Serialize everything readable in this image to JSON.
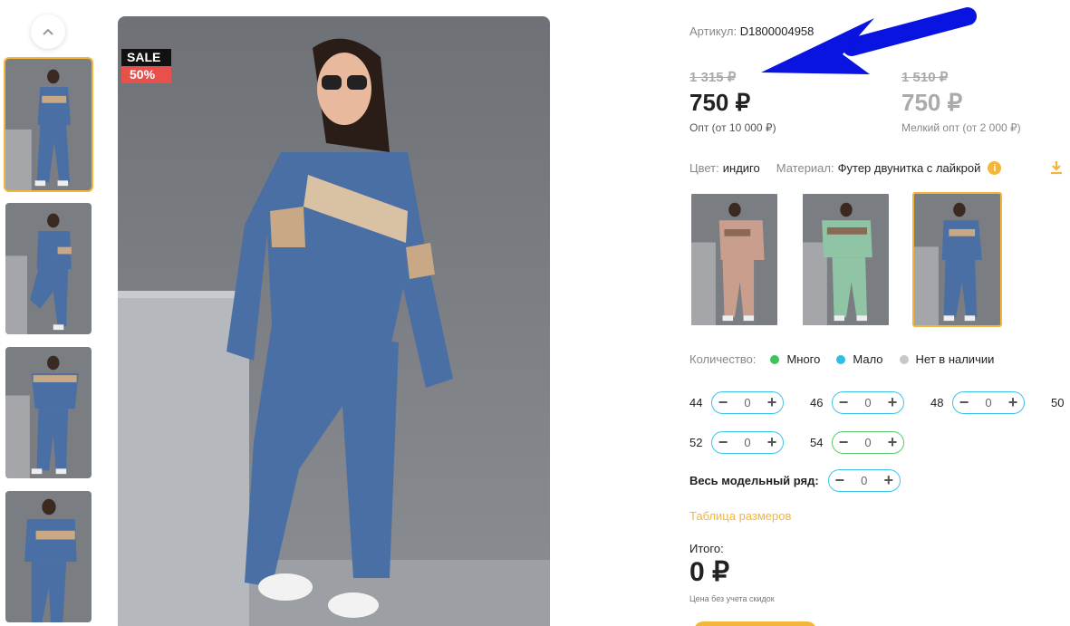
{
  "gallery": {
    "thumbnails": [
      {
        "id": "t1"
      },
      {
        "id": "t2"
      },
      {
        "id": "t3"
      },
      {
        "id": "t4"
      }
    ],
    "badge": {
      "top": "SALE",
      "bottom": "50%"
    }
  },
  "product": {
    "sku_label": "Артикул:",
    "sku_value": "D1800004958",
    "wholesale": {
      "old": "1 315 ₽",
      "price": "750 ₽",
      "note": "Опт (от 10 000 ₽)"
    },
    "small_wholesale": {
      "old": "1 510 ₽",
      "price": "750 ₽",
      "note": "Мелкий опт (от 2 000 ₽)"
    },
    "color_label": "Цвет:",
    "color_value": "индиго",
    "material_label": "Материал:",
    "material_value": "Футер двунитка с лайкрой",
    "info_icon": "i",
    "colors": [
      "пудра",
      "мята",
      "индиго"
    ]
  },
  "availability": {
    "label": "Количество:",
    "items": [
      {
        "label": "Много",
        "color": "#3ec55a"
      },
      {
        "label": "Мало",
        "color": "#2fbde8"
      },
      {
        "label": "Нет в наличии",
        "color": "#c8c8c8"
      }
    ]
  },
  "sizes": {
    "row1": [
      {
        "size": "44",
        "qty": "0"
      },
      {
        "size": "46",
        "qty": "0"
      },
      {
        "size": "48",
        "qty": "0"
      },
      {
        "size": "50",
        "qty": ""
      }
    ],
    "row2": [
      {
        "size": "52",
        "qty": "0"
      },
      {
        "size": "54",
        "qty": "0"
      }
    ],
    "minus": "−",
    "plus": "+",
    "full_label": "Весь модельный ряд:",
    "full_qty": "0"
  },
  "size_table_link": "Таблица размеров",
  "total": {
    "label": "Итого:",
    "value": "0 ₽",
    "note": "Цена без учета скидок"
  },
  "colors": {
    "accent": "#f3b53a",
    "stepper": "#3cc4e8",
    "stepper_green": "#57c96a",
    "arrow": "#0a14e0"
  }
}
